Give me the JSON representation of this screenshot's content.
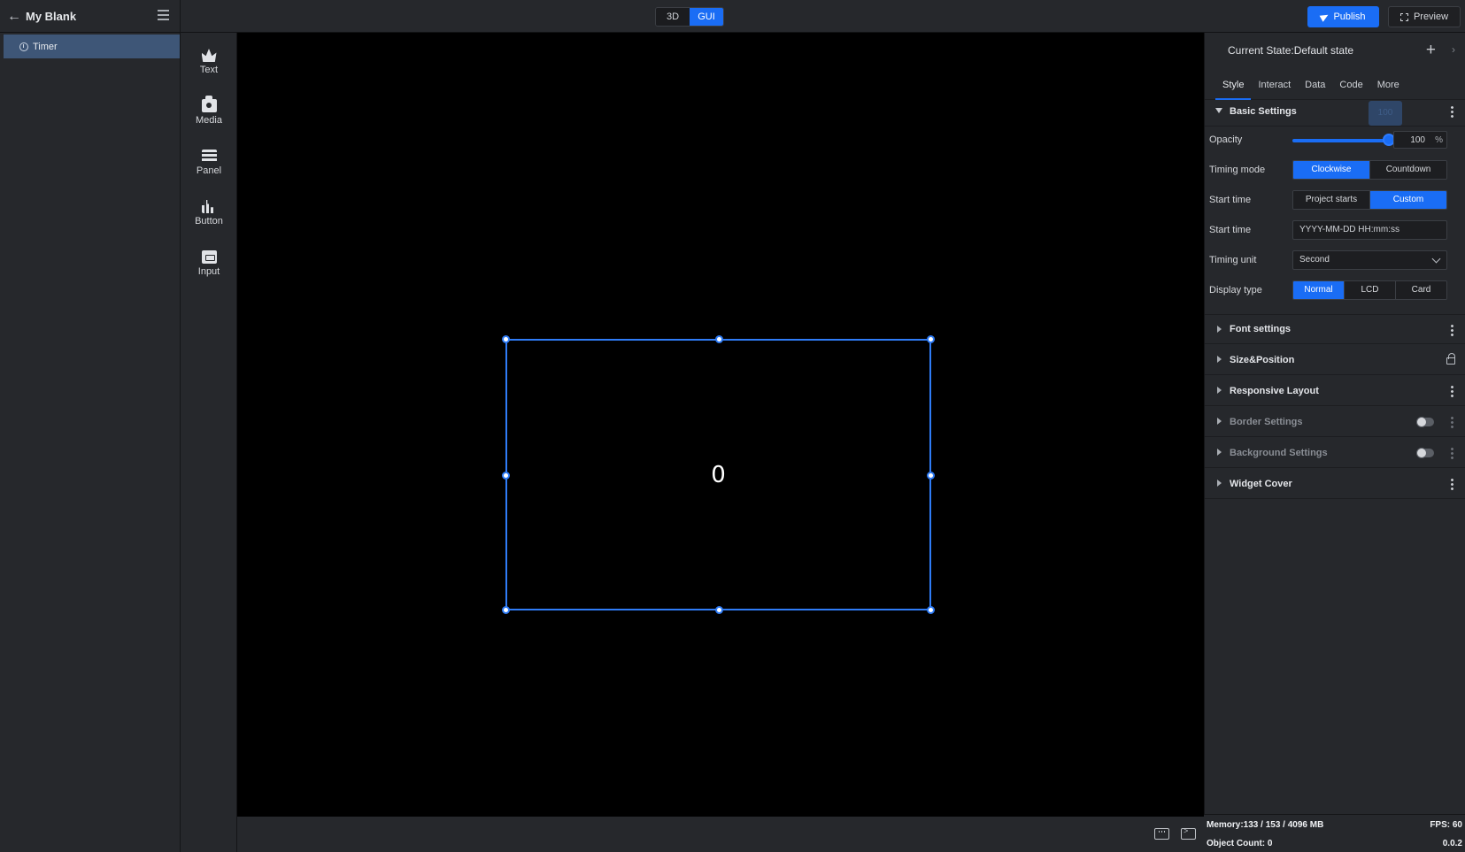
{
  "header": {
    "project_name": "My Blank",
    "mode_3d": "3D",
    "mode_gui": "GUI",
    "active_mode": "GUI",
    "publish_label": "Publish",
    "preview_label": "Preview"
  },
  "layers": {
    "items": [
      {
        "label": "Timer",
        "icon": "clock-icon",
        "selected": true
      }
    ]
  },
  "widgets": [
    {
      "label": "Text",
      "icon": "crown-icon"
    },
    {
      "label": "Media",
      "icon": "camera-icon"
    },
    {
      "label": "Panel",
      "icon": "panel-icon"
    },
    {
      "label": "Button",
      "icon": "bar-chart-icon"
    },
    {
      "label": "Input",
      "icon": "input-icon"
    }
  ],
  "canvas": {
    "timer_value": "0"
  },
  "props": {
    "state": "Current State:Default state",
    "tabs": [
      "Style",
      "Interact",
      "Data",
      "Code",
      "More"
    ],
    "active_tab": "Style",
    "basic_settings": {
      "title": "Basic Settings",
      "opacity_label": "Opacity",
      "opacity_value": "100",
      "opacity_unit": "%",
      "opacity_percent": 100,
      "tooltip": "100",
      "timing_mode_label": "Timing mode",
      "timing_mode_options": [
        "Clockwise",
        "Countdown"
      ],
      "timing_mode_selected": "Clockwise",
      "start_time_label": "Start time",
      "start_time_options": [
        "Project starts",
        "Custom"
      ],
      "start_time_selected": "Custom",
      "start_time_input_label": "Start time",
      "start_time_placeholder": "YYYY-MM-DD HH:mm:ss",
      "timing_unit_label": "Timing unit",
      "timing_unit_value": "Second",
      "display_type_label": "Display type",
      "display_type_options": [
        "Normal",
        "LCD",
        "Card"
      ],
      "display_type_selected": "Normal"
    },
    "sections": {
      "font": "Font settings",
      "size": "Size&Position",
      "responsive": "Responsive Layout",
      "border": "Border Settings",
      "background": "Background Settings",
      "cover": "Widget Cover"
    }
  },
  "status": {
    "memory": "Memory:133 / 153 / 4096 MB",
    "fps": "FPS: 60",
    "object_count": "Object Count: 0",
    "version": "0.0.2"
  },
  "colors": {
    "accent": "#1a6df5",
    "panel_bg": "#26282c",
    "canvas_bg": "#000000",
    "selection": "#2f7cf6"
  }
}
